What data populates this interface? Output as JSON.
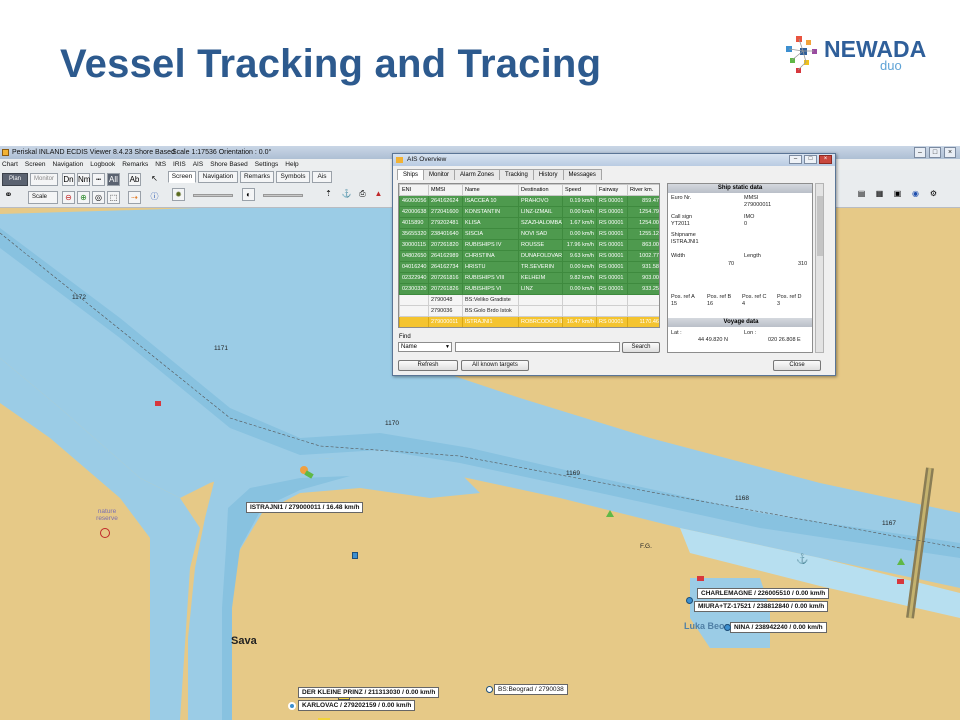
{
  "slide": {
    "title": "Vessel Tracking and Tracing"
  },
  "logo": {
    "name": "NEWADA",
    "sub": "duo"
  },
  "app": {
    "title": "Periskal INLAND ECDIS Viewer 8.4.23  Shore Based",
    "scale_info": "Scale 1:17536 Orientation :  0.0°",
    "window_buttons": [
      "–",
      "□",
      "×"
    ],
    "menu": [
      "Chart",
      "Screen",
      "Navigation",
      "Logbook",
      "Remarks",
      "NtS",
      "IRIS",
      "AIS",
      "Shore Based",
      "Settings",
      "Help"
    ],
    "toolbar": {
      "plan": "Plan",
      "monitor": "Monitor",
      "scale": "Scale",
      "dn": "Dn",
      "nm": "Nm",
      "all": "All",
      "ab": "Ab"
    },
    "tabs": [
      "Screen",
      "Navigation",
      "Remarks",
      "Symbols",
      "Ais"
    ]
  },
  "map": {
    "km_labels": [
      "1172",
      "1171",
      "1170",
      "1169",
      "1168",
      "1167"
    ],
    "fairway": "F.G.",
    "nature_reserve": "nature reserve",
    "city": "Sava",
    "port": "Luka Beograd",
    "vessels": [
      "ISTRAJNI1 / 279000011 / 16.48 km/h",
      "CHARLEMAGNE / 226005510 / 0.00 km/h",
      "MIURA+TZ-17521 / 238812840 / 0.00 km/h",
      "NINA / 238942240 / 0.00 km/h",
      "DER KLEINE PRINZ / 211313030 / 0.00 km/h",
      "KARLOVAC / 279202159 / 0.00 km/h",
      "BS:Beograd / 2790038"
    ]
  },
  "ais_dialog": {
    "title": "AIS Overview",
    "tabs": [
      "Ships",
      "Monitor",
      "Alarm Zones",
      "Tracking",
      "History",
      "Messages"
    ],
    "columns": [
      "ENI",
      "MMSI",
      "Name",
      "Destination",
      "Speed",
      "Fairway",
      "River km."
    ],
    "rows": [
      [
        "46000056",
        "264162624",
        "ISACCEA 10",
        "PRAHOVO",
        "0.19 km/h",
        "RS 00001",
        "859.47"
      ],
      [
        "42000638",
        "272041600",
        "KONSTANTIN",
        "LINZ-IZMAIL",
        "0.00 km/h",
        "RS 00001",
        "1254.79"
      ],
      [
        "4015890",
        "279202481",
        "KLISA",
        "SZAZHALOMBAT",
        "1.67 km/h",
        "RS 00001",
        "1254.00"
      ],
      [
        "35655320",
        "238401640",
        "SISCIA",
        "NOVI SAD",
        "0.00 km/h",
        "RS 00001",
        "1255.12"
      ],
      [
        "30000115",
        "207261820",
        "RUBISHIPS IV",
        "ROUSSE",
        "17.96 km/h",
        "RS 00001",
        "863.00"
      ],
      [
        "04802650",
        "264162989",
        "CHRISTINA",
        "DUNAFOLDVAR",
        "9.63 km/h",
        "RS 00001",
        "1002.77"
      ],
      [
        "04016240",
        "264162734",
        "HRISTU",
        "TR.SEVERIN",
        "0.00 km/h",
        "RS 00001",
        "931.58"
      ],
      [
        "02322940",
        "207261816",
        "RUBISHIPS VIII",
        "KELHEIM",
        "9.82 km/h",
        "RS 00001",
        "903.00"
      ],
      [
        "02300320",
        "207261826",
        "RUBISHIPS VI",
        "LINZ",
        "0.00 km/h",
        "RS 00001",
        "933.25"
      ],
      [
        "",
        "2790048",
        "BS:Veliko Gradiste",
        "",
        "",
        "",
        ""
      ],
      [
        "",
        "2790036",
        "BS:Golo Brdo Istok",
        "",
        "",
        "",
        ""
      ],
      [
        "",
        "279000011",
        "ISTRAJNI1",
        "ROBRCODOO ILIST",
        "16.47 km/h",
        "RS 00001",
        "1170.46"
      ]
    ],
    "find_label": "Find",
    "find_field": "Name",
    "find_value": "",
    "search": "Search",
    "refresh": "Refresh",
    "all_known": "All known targets",
    "close": "Close",
    "static": {
      "header": "Ship static data",
      "euro_nr_label": "Euro Nr.",
      "euro_nr": "",
      "mmsi_label": "MMSI",
      "mmsi": "279000011",
      "callsign_label": "Call sign",
      "callsign": "YT2011",
      "imo_label": "IMO",
      "imo": "0",
      "shipname_label": "Shipname",
      "shipname": "ISTRAJNI1",
      "width_label": "Width",
      "width": "70",
      "length_label": "Length",
      "length": "310",
      "posA_label": "Pos. ref A",
      "posA": "15",
      "posB_label": "Pos. ref B",
      "posB": "16",
      "posC_label": "Pos. ref C",
      "posC": "4",
      "posD_label": "Pos. ref D",
      "posD": "3"
    },
    "voyage": {
      "header": "Voyage data",
      "lat_label": "Lat :",
      "lat": "44 49.820 N",
      "lon_label": "Lon :",
      "lon": "020 26.808 E"
    }
  }
}
